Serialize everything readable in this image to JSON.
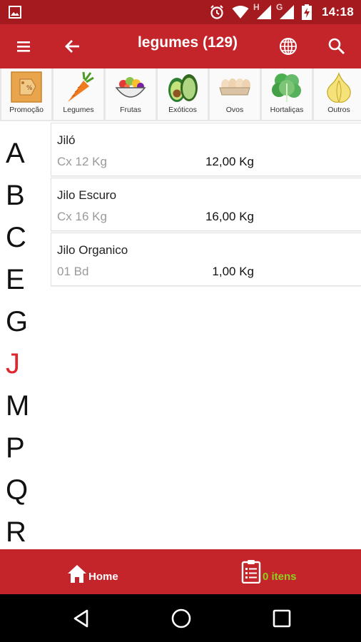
{
  "status_bar": {
    "time": "14:18",
    "icons": [
      "image-icon",
      "alarm-icon",
      "wifi-icon",
      "signal-h-icon",
      "signal-g-icon",
      "battery-charging-icon"
    ],
    "signal_h": "H",
    "signal_g": "G"
  },
  "app_bar": {
    "title": "legumes (129)",
    "menu_icon": "menu-icon",
    "back_icon": "arrow-back-icon",
    "globe_icon": "globe-icon",
    "search_icon": "search-icon"
  },
  "categories": [
    {
      "label": "Promoção",
      "icon": "promo-tag-icon"
    },
    {
      "label": "Legumes",
      "icon": "carrot-icon"
    },
    {
      "label": "Frutas",
      "icon": "fruit-bowl-icon"
    },
    {
      "label": "Exóticos",
      "icon": "avocado-icon"
    },
    {
      "label": "Ovos",
      "icon": "eggs-icon"
    },
    {
      "label": "Hortaliças",
      "icon": "lettuce-icon"
    },
    {
      "label": "Outros",
      "icon": "garlic-icon"
    }
  ],
  "alphabet": {
    "letters": [
      "A",
      "B",
      "C",
      "E",
      "G",
      "J",
      "M",
      "P",
      "Q",
      "R"
    ],
    "active": "J",
    "active_color": "#e0252b"
  },
  "products": [
    {
      "name": "Jiló",
      "pack": "Cx 12 Kg",
      "weight": "12,00 Kg"
    },
    {
      "name": "Jilo Escuro",
      "pack": "Cx 16 Kg",
      "weight": "16,00 Kg"
    },
    {
      "name": "Jilo Organico",
      "pack": "01 Bd",
      "weight": "1,00 Kg"
    }
  ],
  "bottom_bar": {
    "home_label": "Home",
    "home_icon": "home-icon",
    "cart_label": "0 itens",
    "cart_icon": "clipboard-list-icon",
    "cart_color": "#8bd11f"
  },
  "nav_bar": {
    "icons": [
      "nav-back-icon",
      "nav-home-icon",
      "nav-recents-icon"
    ]
  },
  "colors": {
    "status_bar": "#a51a1f",
    "app_bar": "#c4252b"
  }
}
